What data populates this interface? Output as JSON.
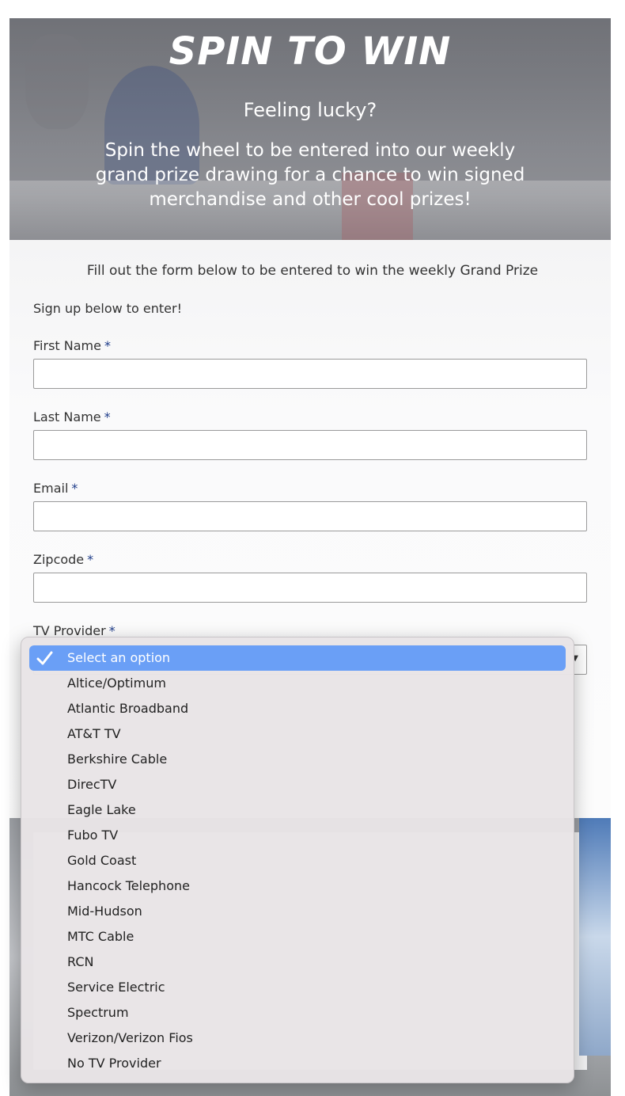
{
  "hero": {
    "title": "SPIN TO WIN",
    "subtitle": "Feeling lucky?",
    "body": "Spin the wheel to be entered into our weekly grand prize drawing for a chance to win signed merchandise and other cool prizes!"
  },
  "intro": "Fill out the form below to be entered to win the weekly Grand Prize",
  "signup_text": "Sign up below to enter!",
  "required_marker": "*",
  "fields": [
    {
      "label": "First Name",
      "value": ""
    },
    {
      "label": "Last Name",
      "value": ""
    },
    {
      "label": "Email",
      "value": ""
    },
    {
      "label": "Zipcode",
      "value": ""
    }
  ],
  "tv_provider": {
    "label": "TV Provider",
    "selected": "Select an option",
    "options": [
      "Select an option",
      "Altice/Optimum",
      "Atlantic Broadband",
      "AT&T TV",
      "Berkshire Cable",
      "DirecTV",
      "Eagle Lake",
      "Fubo TV",
      "Gold Coast",
      "Hancock Telephone",
      "Mid-Hudson",
      "MTC Cable",
      "RCN",
      "Service Electric",
      "Spectrum",
      "Verizon/Verizon Fios",
      "No TV Provider"
    ]
  },
  "colors": {
    "required": "#1f3d8a",
    "selected_option_bg": "#6a9ff6"
  },
  "icons": {
    "selected_check": "checkmark-icon",
    "select_arrow": "chevron-down-icon"
  }
}
